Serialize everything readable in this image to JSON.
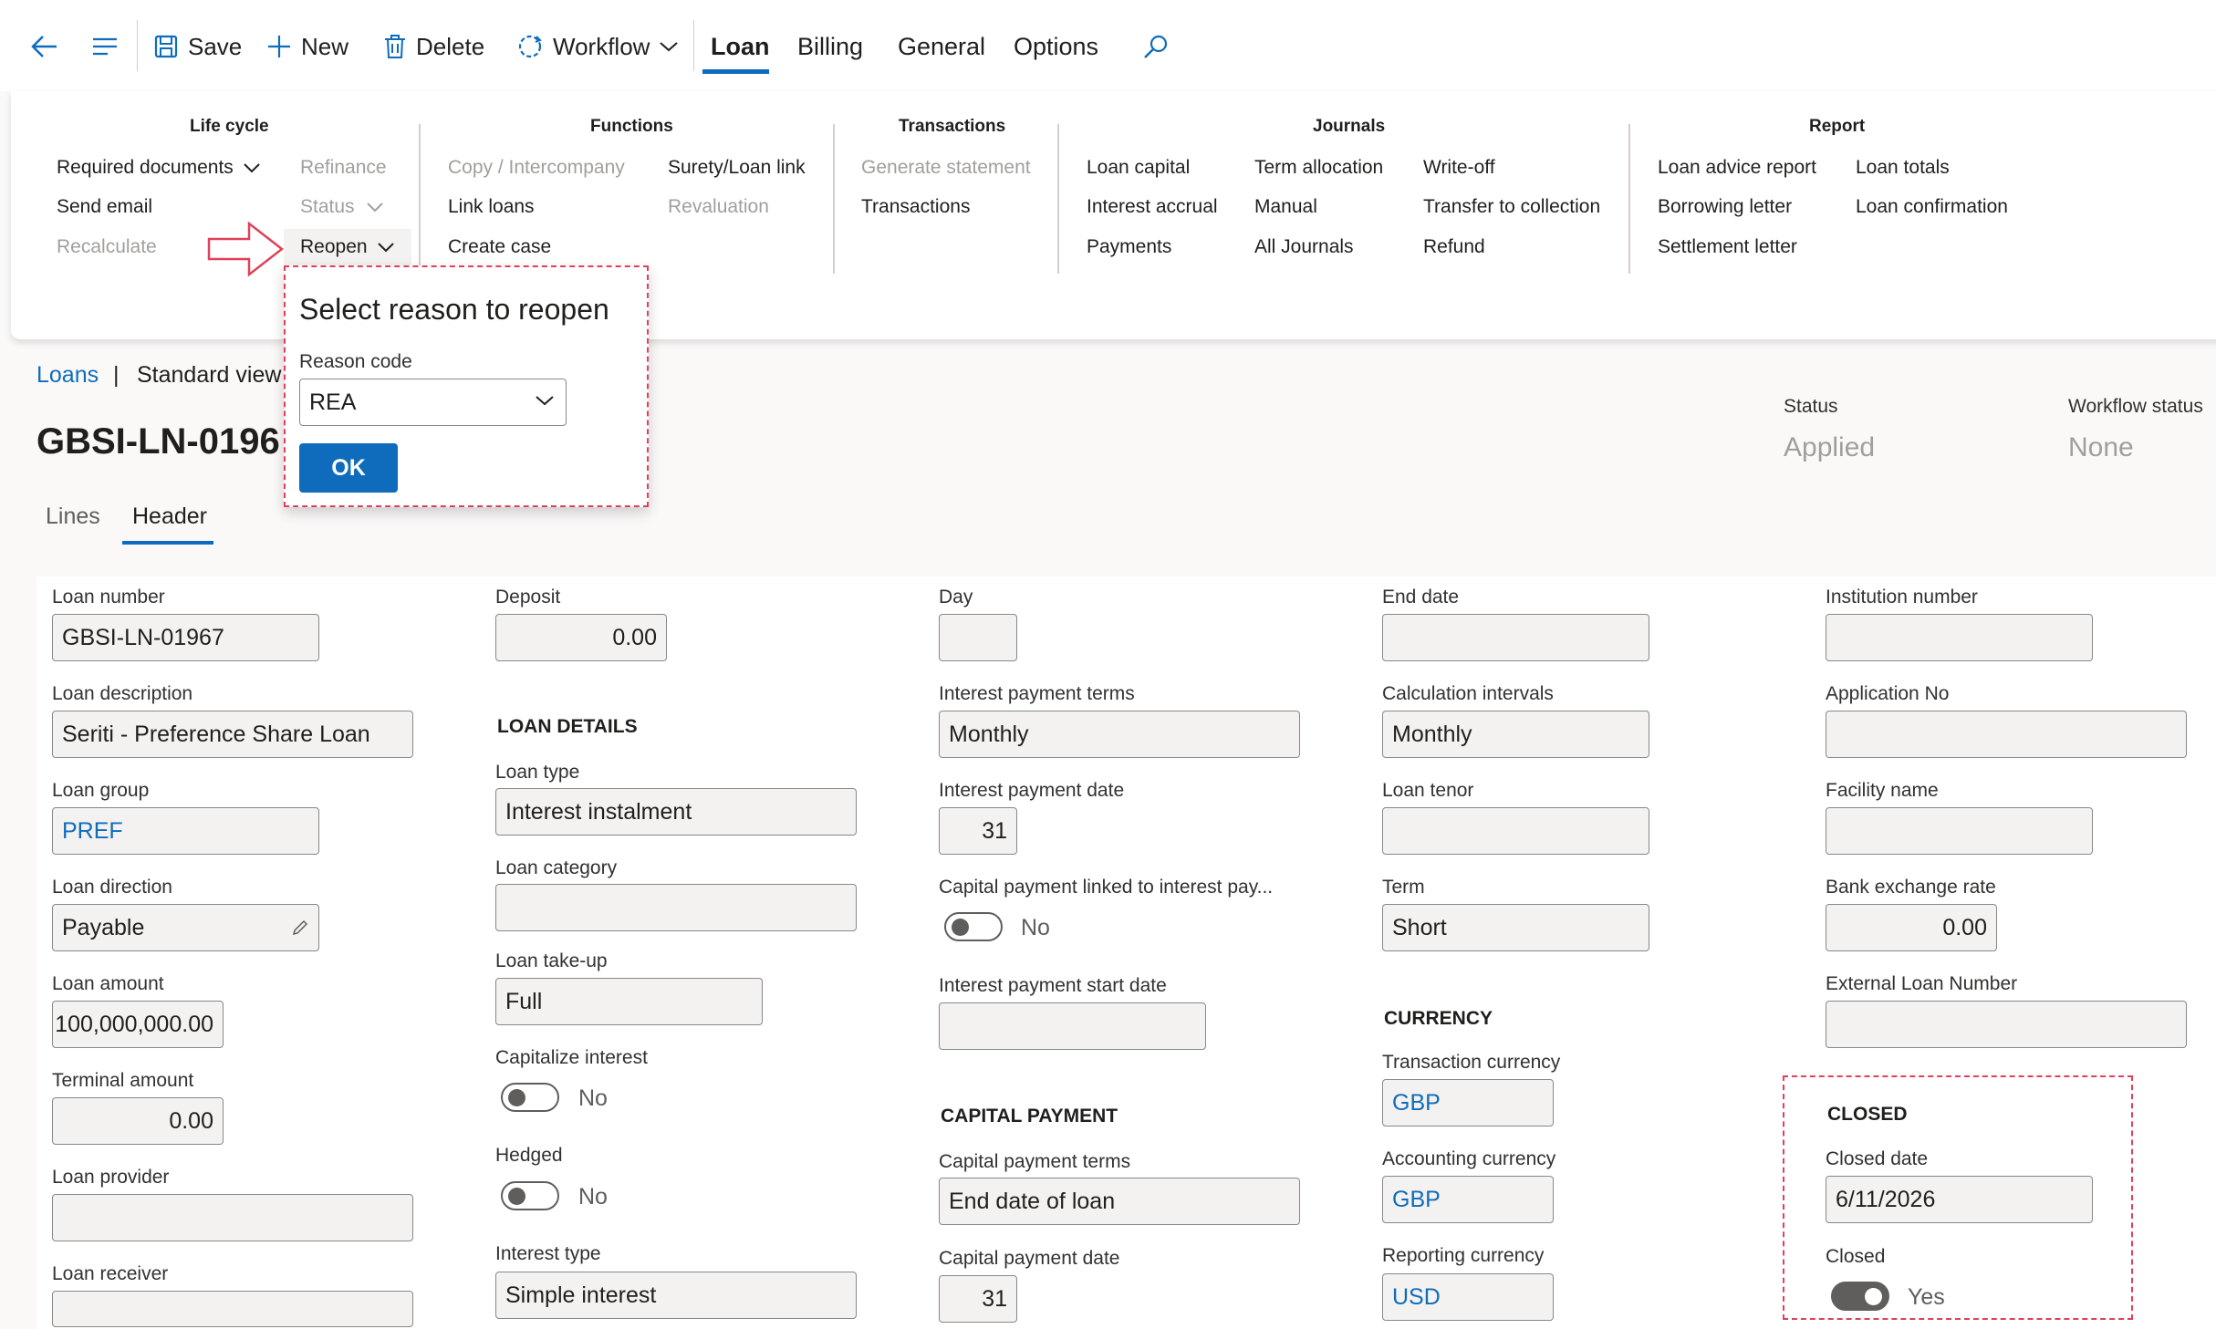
{
  "actionbar": {
    "save": "Save",
    "new": "New",
    "delete": "Delete",
    "workflow": "Workflow",
    "tabs": [
      "Loan",
      "Billing",
      "General",
      "Options"
    ],
    "active_tab": "Loan",
    "icons": [
      "back-arrow-icon",
      "menu-icon",
      "save-icon",
      "plus-icon",
      "trash-icon",
      "workflow-icon",
      "chevron-down-icon",
      "search-icon"
    ]
  },
  "ribbon": {
    "lifecycle": {
      "title": "Life cycle",
      "required_documents": "Required documents",
      "send_email": "Send email",
      "recalculate": "Recalculate",
      "refinance": "Refinance",
      "status": "Status",
      "reopen": "Reopen"
    },
    "functions": {
      "title": "Functions",
      "copy_intercompany": "Copy / Intercompany",
      "link_loans": "Link loans",
      "create_case": "Create case",
      "surety_loan_link": "Surety/Loan link",
      "revaluation": "Revaluation"
    },
    "transactions": {
      "title": "Transactions",
      "generate_statement": "Generate statement",
      "transactions": "Transactions"
    },
    "journals": {
      "title": "Journals",
      "loan_capital": "Loan capital",
      "interest_accrual": "Interest accrual",
      "payments": "Payments",
      "term_allocation": "Term allocation",
      "manual": "Manual",
      "all_journals": "All Journals",
      "write_off": "Write-off",
      "transfer_to_collection": "Transfer to collection",
      "refund": "Refund"
    },
    "report": {
      "title": "Report",
      "loan_advice_report": "Loan advice report",
      "borrowing_letter": "Borrowing letter",
      "settlement_letter": "Settlement letter",
      "loan_totals": "Loan totals",
      "loan_confirmation": "Loan confirmation"
    }
  },
  "breadcrumb": {
    "link": "Loans",
    "separator": "|",
    "view": "Standard view"
  },
  "page": {
    "title": "GBSI-LN-0196",
    "status_label": "Status",
    "status_value": "Applied",
    "workflow_label": "Workflow status",
    "workflow_value": "None",
    "tabs": [
      "Lines",
      "Header"
    ],
    "active_tab": "Header"
  },
  "popup": {
    "title": "Select reason to reopen",
    "reason_label": "Reason code",
    "reason_value": "REA",
    "ok": "OK"
  },
  "form": {
    "col1": {
      "loan_number_label": "Loan number",
      "loan_number": "GBSI-LN-01967",
      "loan_description_label": "Loan description",
      "loan_description": "Seriti - Preference Share Loan",
      "loan_group_label": "Loan group",
      "loan_group": "PREF",
      "loan_direction_label": "Loan direction",
      "loan_direction": "Payable",
      "loan_amount_label": "Loan amount",
      "loan_amount": "100,000,000.00",
      "terminal_amount_label": "Terminal amount",
      "terminal_amount": "0.00",
      "loan_provider_label": "Loan provider",
      "loan_provider": "",
      "loan_receiver_label": "Loan receiver",
      "loan_receiver": ""
    },
    "col2": {
      "deposit_label": "Deposit",
      "deposit": "0.00",
      "section_loan_details": "LOAN DETAILS",
      "loan_type_label": "Loan type",
      "loan_type": "Interest instalment",
      "loan_category_label": "Loan category",
      "loan_category": "",
      "loan_takeup_label": "Loan take-up",
      "loan_takeup": "Full",
      "capitalize_interest_label": "Capitalize interest",
      "capitalize_interest": "No",
      "hedged_label": "Hedged",
      "hedged": "No",
      "interest_type_label": "Interest type",
      "interest_type": "Simple interest"
    },
    "col3": {
      "day_label": "Day",
      "day": "",
      "interest_payment_terms_label": "Interest payment terms",
      "interest_payment_terms": "Monthly",
      "interest_payment_date_label": "Interest payment date",
      "interest_payment_date": "31",
      "capital_linked_label": "Capital payment linked to interest pay...",
      "capital_linked": "No",
      "interest_start_date_label": "Interest payment start date",
      "interest_start_date": "",
      "section_capital_payment": "CAPITAL PAYMENT",
      "capital_payment_terms_label": "Capital payment terms",
      "capital_payment_terms": "End date of loan",
      "capital_payment_date_label": "Capital payment date",
      "capital_payment_date": "31"
    },
    "col4": {
      "end_date_label": "End date",
      "end_date": "",
      "calculation_intervals_label": "Calculation intervals",
      "calculation_intervals": "Monthly",
      "loan_tenor_label": "Loan tenor",
      "loan_tenor": "",
      "term_label": "Term",
      "term": "Short",
      "section_currency": "CURRENCY",
      "transaction_currency_label": "Transaction currency",
      "transaction_currency": "GBP",
      "accounting_currency_label": "Accounting currency",
      "accounting_currency": "GBP",
      "reporting_currency_label": "Reporting currency",
      "reporting_currency": "USD"
    },
    "col5": {
      "institution_number_label": "Institution number",
      "institution_number": "",
      "application_no_label": "Application No",
      "application_no": "",
      "facility_name_label": "Facility name",
      "facility_name": "",
      "bank_exchange_rate_label": "Bank exchange rate",
      "bank_exchange_rate": "0.00",
      "external_loan_number_label": "External Loan Number",
      "external_loan_number": "",
      "section_closed": "CLOSED",
      "closed_date_label": "Closed date",
      "closed_date": "6/11/2026",
      "closed_label": "Closed",
      "closed": "Yes"
    }
  },
  "colors": {
    "accent": "#0f6cbd",
    "highlight_border": "#e0405a",
    "disabled_text": "#a19f9d"
  }
}
